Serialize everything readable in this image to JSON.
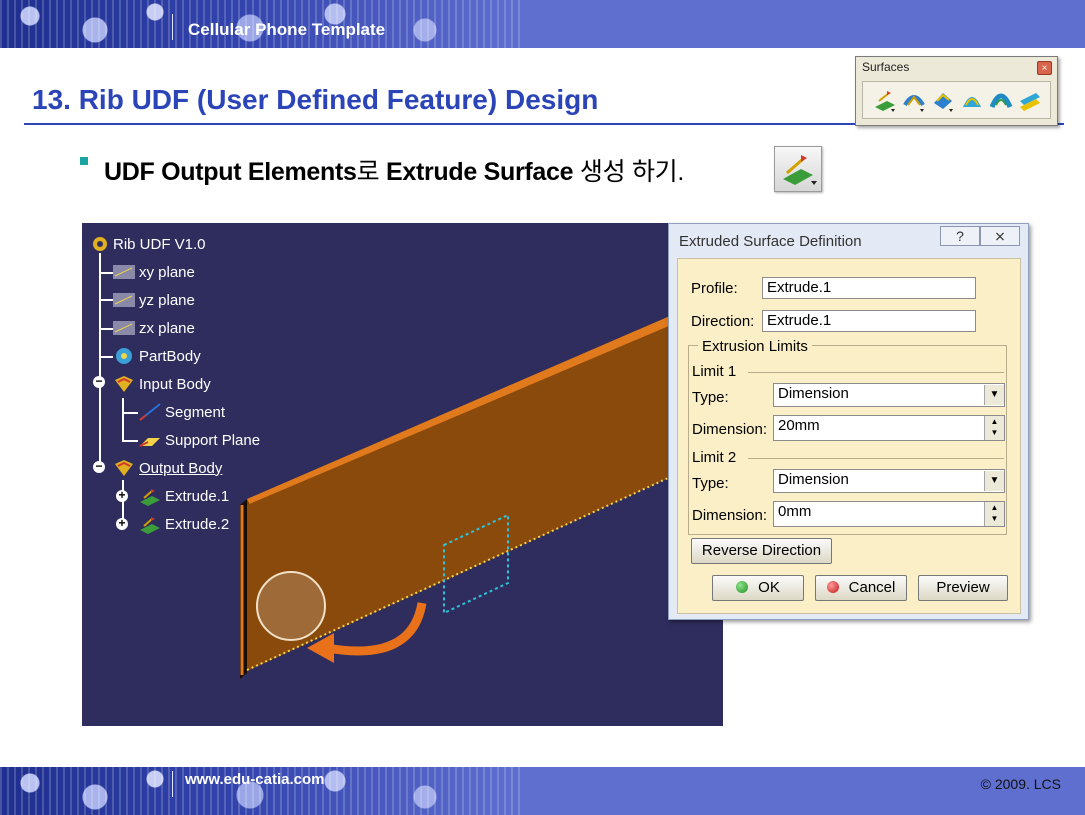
{
  "header": {
    "title": "Cellular Phone Template"
  },
  "slide": {
    "title": "13. Rib UDF (User Defined Feature) Design",
    "bullet": {
      "part1": "UDF Output Elements",
      "part2": "로 ",
      "part3": "Extrude Surface",
      "part4": " 생성 하기."
    }
  },
  "toolbar": {
    "title": "Surfaces",
    "close_label": "×",
    "icons": [
      "extrude-icon",
      "revolve-icon",
      "offset-icon",
      "sweep-icon",
      "fill-icon",
      "blend-icon"
    ]
  },
  "tree": {
    "root": "Rib UDF V1.0",
    "items": [
      {
        "label": "xy plane"
      },
      {
        "label": "yz plane"
      },
      {
        "label": "zx plane"
      },
      {
        "label": "PartBody"
      },
      {
        "label": "Input Body"
      },
      {
        "label": "Segment"
      },
      {
        "label": "Support Plane"
      },
      {
        "label": "Output Body"
      },
      {
        "label": "Extrude.1"
      },
      {
        "label": "Extrude.2"
      }
    ]
  },
  "dialog": {
    "title": "Extruded Surface Definition",
    "help_label": "?",
    "close_label": "⨯",
    "profile_label": "Profile:",
    "profile_value": "Extrude.1",
    "direction_label": "Direction:",
    "direction_value": "Extrude.1",
    "limits_title": "Extrusion Limits",
    "limit1": {
      "title": "Limit 1",
      "type_label": "Type:",
      "type_value": "Dimension",
      "dim_label": "Dimension:",
      "dim_value": "20mm"
    },
    "limit2": {
      "title": "Limit 2",
      "type_label": "Type:",
      "type_value": "Dimension",
      "dim_label": "Dimension:",
      "dim_value": "0mm"
    },
    "reverse_label": "Reverse Direction",
    "ok_label": "OK",
    "cancel_label": "Cancel",
    "preview_label": "Preview"
  },
  "footer": {
    "url": "www.edu-catia.com",
    "copyright": "© 2009. LCS"
  },
  "colors": {
    "accent": "#2b45b8",
    "band": "#5f6fd0",
    "viewport_bg": "#2f2d5e",
    "surface": "#7a3f05",
    "surface_edge": "#e07a1c",
    "arrow": "#e8711a",
    "dialog_body": "#fbefc8"
  }
}
